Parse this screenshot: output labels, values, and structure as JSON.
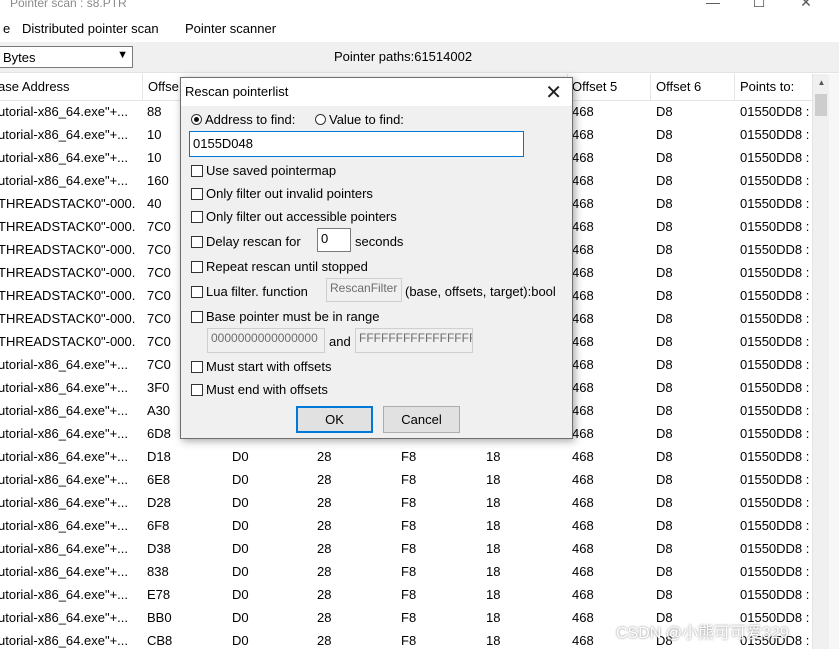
{
  "window": {
    "title": "Pointer scan : s8.PTR",
    "min": "—",
    "max": "☐",
    "close": "✕"
  },
  "menu": [
    "e",
    "Distributed pointer scan",
    "Pointer scanner"
  ],
  "toolbar": {
    "type_value": "Bytes",
    "pointer_paths": "Pointer paths:61514002"
  },
  "columns": [
    "ase Address",
    "Offse",
    "Offset 5",
    "Offset 6",
    "Points to:"
  ],
  "rows": [
    [
      "utorial-x86_64.exe\"+...",
      "88",
      "",
      "",
      "",
      "",
      "468",
      "D8",
      "01550DD8 :"
    ],
    [
      "utorial-x86_64.exe\"+...",
      "10",
      "",
      "",
      "",
      "",
      "468",
      "D8",
      "01550DD8 :"
    ],
    [
      "utorial-x86_64.exe\"+...",
      "10",
      "",
      "",
      "",
      "",
      "468",
      "D8",
      "01550DD8 :"
    ],
    [
      "utorial-x86_64.exe\"+...",
      "160",
      "",
      "",
      "",
      "",
      "468",
      "D8",
      "01550DD8 :"
    ],
    [
      "THREADSTACK0\"-000...",
      "40",
      "",
      "",
      "",
      "",
      "468",
      "D8",
      "01550DD8 :"
    ],
    [
      "THREADSTACK0\"-000...",
      "7C0",
      "",
      "",
      "",
      "",
      "468",
      "D8",
      "01550DD8 :"
    ],
    [
      "THREADSTACK0\"-000...",
      "7C0",
      "",
      "",
      "",
      "",
      "468",
      "D8",
      "01550DD8 :"
    ],
    [
      "THREADSTACK0\"-000...",
      "7C0",
      "",
      "",
      "",
      "",
      "468",
      "D8",
      "01550DD8 :"
    ],
    [
      "THREADSTACK0\"-000...",
      "7C0",
      "",
      "",
      "",
      "",
      "468",
      "D8",
      "01550DD8 :"
    ],
    [
      "THREADSTACK0\"-000...",
      "7C0",
      "",
      "",
      "",
      "",
      "468",
      "D8",
      "01550DD8 :"
    ],
    [
      "THREADSTACK0\"-000...",
      "7C0",
      "",
      "",
      "",
      "",
      "468",
      "D8",
      "01550DD8 :"
    ],
    [
      "utorial-x86_64.exe\"+...",
      "7C0",
      "",
      "",
      "",
      "",
      "468",
      "D8",
      "01550DD8 :"
    ],
    [
      "utorial-x86_64.exe\"+...",
      "3F0",
      "",
      "",
      "",
      "",
      "468",
      "D8",
      "01550DD8 :"
    ],
    [
      "utorial-x86_64.exe\"+...",
      "A30",
      "",
      "",
      "",
      "",
      "468",
      "D8",
      "01550DD8 :"
    ],
    [
      "utorial-x86_64.exe\"+...",
      "6D8",
      "",
      "",
      "",
      "",
      "468",
      "D8",
      "01550DD8 :"
    ],
    [
      "utorial-x86_64.exe\"+...",
      "D18",
      "D0",
      "28",
      "F8",
      "18",
      "468",
      "D8",
      "01550DD8 :"
    ],
    [
      "utorial-x86_64.exe\"+...",
      "6E8",
      "D0",
      "28",
      "F8",
      "18",
      "468",
      "D8",
      "01550DD8 :"
    ],
    [
      "utorial-x86_64.exe\"+...",
      "D28",
      "D0",
      "28",
      "F8",
      "18",
      "468",
      "D8",
      "01550DD8 :"
    ],
    [
      "utorial-x86_64.exe\"+...",
      "6F8",
      "D0",
      "28",
      "F8",
      "18",
      "468",
      "D8",
      "01550DD8 :"
    ],
    [
      "utorial-x86_64.exe\"+...",
      "D38",
      "D0",
      "28",
      "F8",
      "18",
      "468",
      "D8",
      "01550DD8 :"
    ],
    [
      "utorial-x86_64.exe\"+...",
      "838",
      "D0",
      "28",
      "F8",
      "18",
      "468",
      "D8",
      "01550DD8 :"
    ],
    [
      "utorial-x86_64.exe\"+...",
      "E78",
      "D0",
      "28",
      "F8",
      "18",
      "468",
      "D8",
      "01550DD8 :"
    ],
    [
      "utorial-x86_64.exe\"+...",
      "BB0",
      "D0",
      "28",
      "F8",
      "18",
      "468",
      "D8",
      "01550DD8 :"
    ],
    [
      "utorial-x86_64.exe\"+...",
      "CB8",
      "D0",
      "28",
      "F8",
      "18",
      "468",
      "D8",
      "01550DD8 :"
    ]
  ],
  "watermark": "CSDN @小熊可可爱329",
  "dialog": {
    "title": "Rescan pointerlist",
    "close": "✕",
    "radio_address": "Address to find:",
    "radio_value": "Value to find:",
    "address_value": "0155D048",
    "use_saved": "Use saved pointermap",
    "only_invalid": "Only filter out invalid pointers",
    "only_accessible": "Only filter out accessible pointers",
    "delay_label": "Delay rescan for",
    "delay_value": "0",
    "delay_unit": "seconds",
    "repeat": "Repeat rescan until stopped",
    "lua_label": "Lua filter. function",
    "lua_value": "RescanFilter",
    "lua_sig": "(base, offsets, target):bool",
    "base_range": "Base pointer must be in range",
    "range_from": "0000000000000000",
    "range_and": "and",
    "range_to": "FFFFFFFFFFFFFFFF",
    "must_start": "Must start with offsets",
    "must_end": "Must end with offsets",
    "ok": "OK",
    "cancel": "Cancel"
  }
}
